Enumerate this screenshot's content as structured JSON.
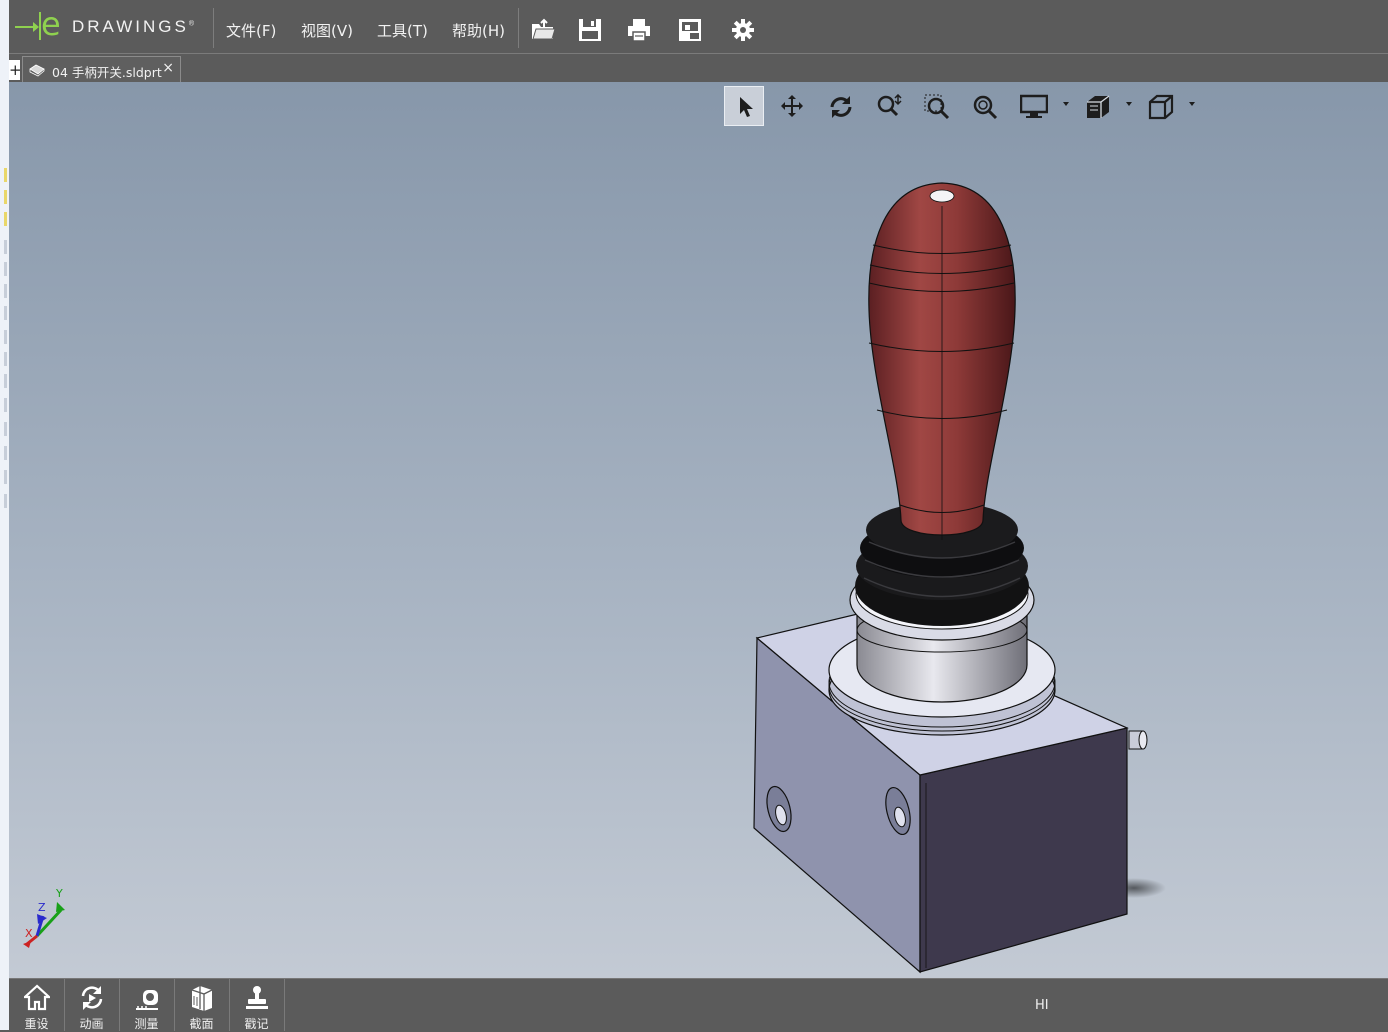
{
  "app": {
    "logo_text": "DRAWINGS",
    "logo_letter": "e"
  },
  "menu": [
    {
      "label": "文件(F)"
    },
    {
      "label": "视图(V)"
    },
    {
      "label": "工具(T)"
    },
    {
      "label": "帮助(H)"
    }
  ],
  "menubar_icons": [
    "open-folder-icon",
    "save-icon",
    "print-icon",
    "sheet-format-icon",
    "settings-gear-icon"
  ],
  "tabs": {
    "add_label": "+",
    "items": [
      {
        "label": "04 手柄开关.sldprt",
        "close": "×"
      }
    ]
  },
  "view_toolbar": [
    "select-arrow-icon",
    "pan-icon",
    "rotate-icon",
    "zoom-in-out-icon",
    "zoom-to-area-icon",
    "zoom-to-fit-icon",
    "display-style-icon",
    "view-orientation-icon",
    "standard-views-icon"
  ],
  "triad": {
    "x": "X",
    "y": "Y",
    "z": "Z"
  },
  "bottom_toolbar": [
    {
      "label": "重设",
      "icon": "home-icon"
    },
    {
      "label": "动画",
      "icon": "animate-icon"
    },
    {
      "label": "测量",
      "icon": "measure-icon"
    },
    {
      "label": "截面",
      "icon": "section-icon"
    },
    {
      "label": "戳记",
      "icon": "stamp-icon"
    }
  ],
  "status_text": "HI",
  "colors": {
    "chrome": "#5b5b5b",
    "accent": "#8fd14f",
    "handle": "#8e3a38",
    "box": "#cfd2e6",
    "boot": "#0f0f10"
  }
}
